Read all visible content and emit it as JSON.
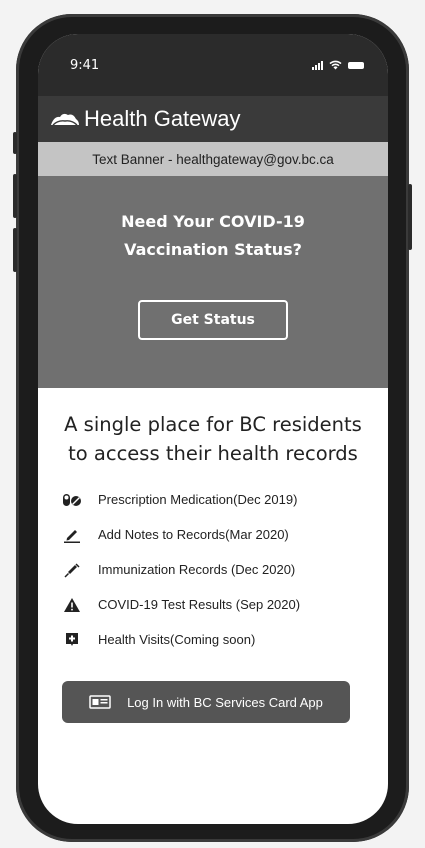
{
  "status_bar": {
    "time": "9:41"
  },
  "header": {
    "app_name": "Health Gateway",
    "logo_icon": "mountain-logo-icon"
  },
  "banner": {
    "text": "Text Banner - healthgateway@gov.bc.ca"
  },
  "hero": {
    "title": "Need Your COVID-19 Vaccination Status?",
    "button_label": "Get Status"
  },
  "main": {
    "tagline": "A single place for BC residents to access their health records",
    "features": [
      {
        "icon": "pill-icon",
        "label": "Prescription Medication(Dec 2019)"
      },
      {
        "icon": "pencil-icon",
        "label": "Add Notes to Records(Mar 2020)"
      },
      {
        "icon": "syringe-icon",
        "label": "Immunization Records (Dec 2020)"
      },
      {
        "icon": "warning-icon",
        "label": "COVID-19 Test Results (Sep 2020)"
      },
      {
        "icon": "clinic-icon",
        "label": "Health Visits(Coming soon)"
      }
    ],
    "login_button": {
      "icon": "id-card-icon",
      "label": "Log In with BC Services Card App"
    }
  },
  "colors": {
    "header_bg": "#3a3a3a",
    "banner_bg": "#c4c4c4",
    "hero_bg": "#707070",
    "login_bg": "#555555"
  }
}
